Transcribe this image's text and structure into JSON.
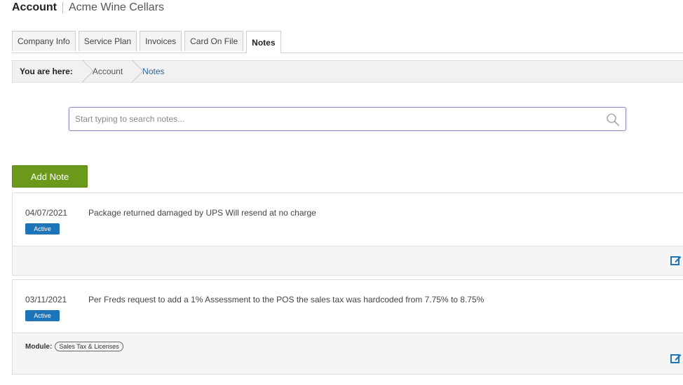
{
  "header": {
    "title": "Account",
    "subtitle": "Acme Wine Cellars"
  },
  "tabs": [
    {
      "label": "Company Info",
      "active": false
    },
    {
      "label": "Service Plan",
      "active": false
    },
    {
      "label": "Invoices",
      "active": false
    },
    {
      "label": "Card On File",
      "active": false
    },
    {
      "label": "Notes",
      "active": true
    }
  ],
  "breadcrumb": {
    "prefix": "You are here:",
    "items": [
      "Account",
      "Notes"
    ]
  },
  "search": {
    "placeholder": "Start typing to search notes...",
    "value": ""
  },
  "add_note_label": "Add Note",
  "notes": [
    {
      "date": "04/07/2021",
      "status": "Active",
      "text": "Package returned damaged by UPS Will resend at no charge"
    },
    {
      "date": "03/11/2021",
      "status": "Active",
      "text": "Per Freds request to add a 1% Assessment to the POS the sales tax was hardcoded from 7.75% to 8.75%",
      "module_label": "Module:",
      "module_value": "Sales Tax & Licenses"
    }
  ],
  "colors": {
    "accent_green": "#6b9a1a",
    "badge_blue": "#1f73b7",
    "link_blue": "#2a6496"
  },
  "icons": {
    "search": "search-icon",
    "edit": "edit-icon"
  }
}
